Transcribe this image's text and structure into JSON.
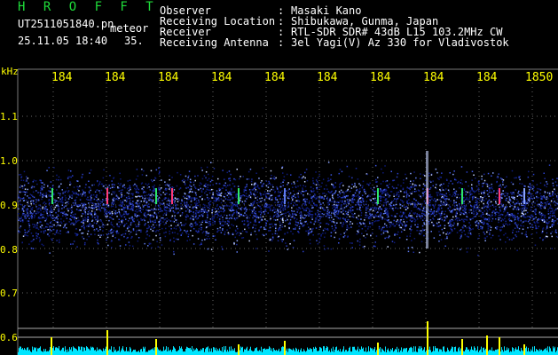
{
  "header": {
    "hrofft": "H R O F F T",
    "filename": "UT2511051840.pn",
    "meteor_label": "meteor",
    "datetime": "25.11.05 18:40",
    "count": "35."
  },
  "info": [
    {
      "label": "Observer",
      "value": "Masaki Kano"
    },
    {
      "label": "Receiving Location",
      "value": "Shibukawa, Gunma, Japan"
    },
    {
      "label": "Receiver",
      "value": "RTL-SDR SDR# 43dB L15 103.2MHz CW"
    },
    {
      "label": "Receiving Antenna",
      "value": "3el Yagi(V) Az 330 for Vladivostok"
    }
  ],
  "axes": {
    "unit": "kHz",
    "x_ticks": [
      "184",
      "184",
      "184",
      "184",
      "184",
      "184",
      "184",
      "184",
      "184",
      "1850"
    ],
    "y_ticks": [
      "1.1",
      "1.0",
      "0.9",
      "0.8",
      "0.7",
      "0.6"
    ]
  },
  "colors": {
    "background": "#000000",
    "label_green": "#1fdc3a",
    "text_white": "#ffffff",
    "axis_yellow": "#ffff00",
    "noise_blue": "#1a2aa0",
    "bars_cyan": "#00e5ff"
  }
}
